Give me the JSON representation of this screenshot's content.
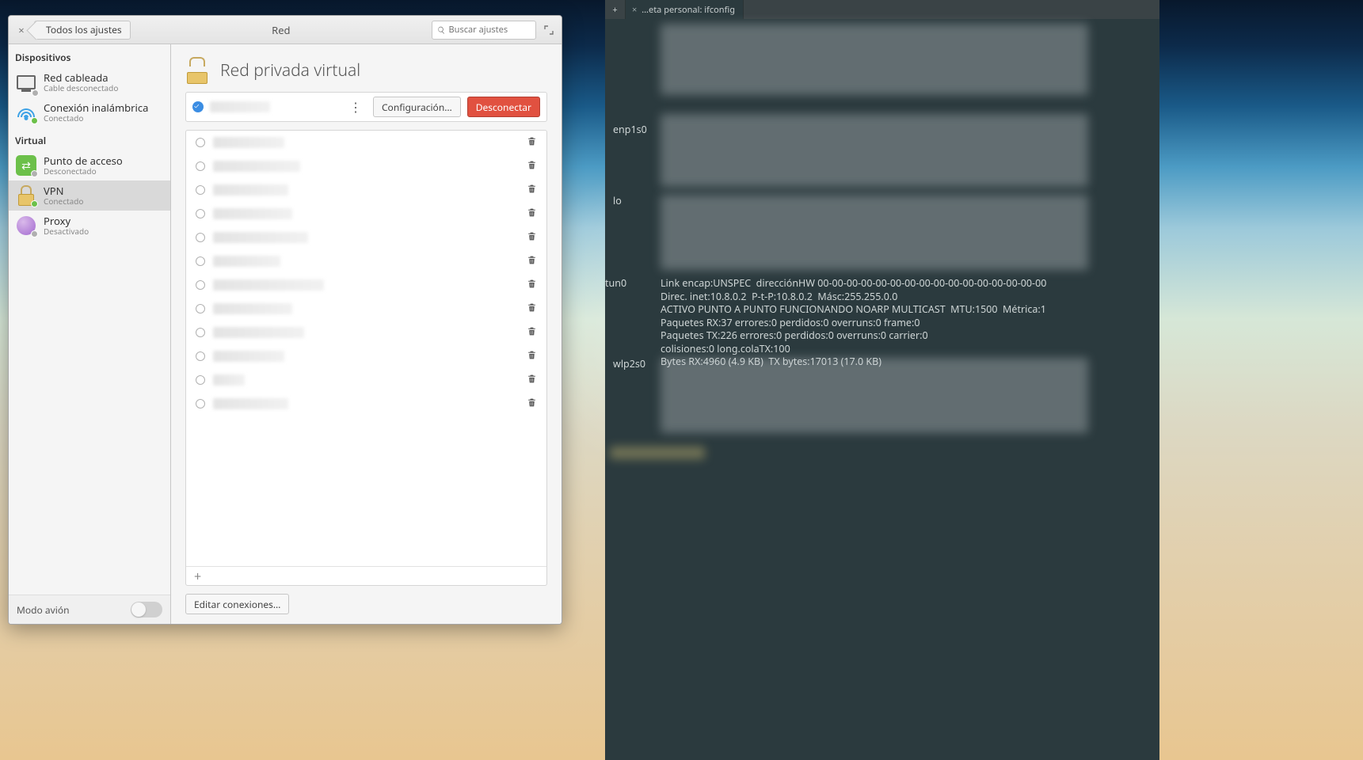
{
  "settings": {
    "back_label": "Todos los ajustes",
    "window_title": "Red",
    "search_placeholder": "Buscar ajustes",
    "sections": {
      "devices_header": "Dispositivos",
      "virtual_header": "Virtual"
    },
    "sidebar": {
      "wired": {
        "title": "Red cableada",
        "sub": "Cable desconectado"
      },
      "wifi": {
        "title": "Conexión inalámbrica",
        "sub": "Conectado"
      },
      "hotspot": {
        "title": "Punto de acceso",
        "sub": "Desconectado"
      },
      "vpn": {
        "title": "VPN",
        "sub": "Conectado"
      },
      "proxy": {
        "title": "Proxy",
        "sub": "Desactivado"
      }
    },
    "airplane_label": "Modo avión",
    "main_title": "Red privada virtual",
    "buttons": {
      "config": "Configuración…",
      "disconnect": "Desconectar",
      "edit_connections": "Editar conexiones…"
    },
    "conn_count": 12
  },
  "terminal": {
    "tab_title": "…eta personal: ifconfig",
    "interfaces": {
      "enp1s0": "enp1s0",
      "lo": "lo",
      "tun0": "tun0",
      "wlp2s0": "wlp2s0"
    },
    "tun0": {
      "l1": "Link encap:UNSPEC  direcciónHW 00-00-00-00-00-00-00-00-00-00-00-00-00-00-00-00",
      "l2": "Direc. inet:10.8.0.2  P-t-P:10.8.0.2  Másc:255.255.0.0",
      "l3": "ACTIVO PUNTO A PUNTO FUNCIONANDO NOARP MULTICAST  MTU:1500  Métrica:1",
      "l4": "Paquetes RX:37 errores:0 perdidos:0 overruns:0 frame:0",
      "l5": "Paquetes TX:226 errores:0 perdidos:0 overruns:0 carrier:0",
      "l6": "colisiones:0 long.colaTX:100",
      "l7": "Bytes RX:4960 (4.9 KB)  TX bytes:17013 (17.0 KB)"
    }
  }
}
